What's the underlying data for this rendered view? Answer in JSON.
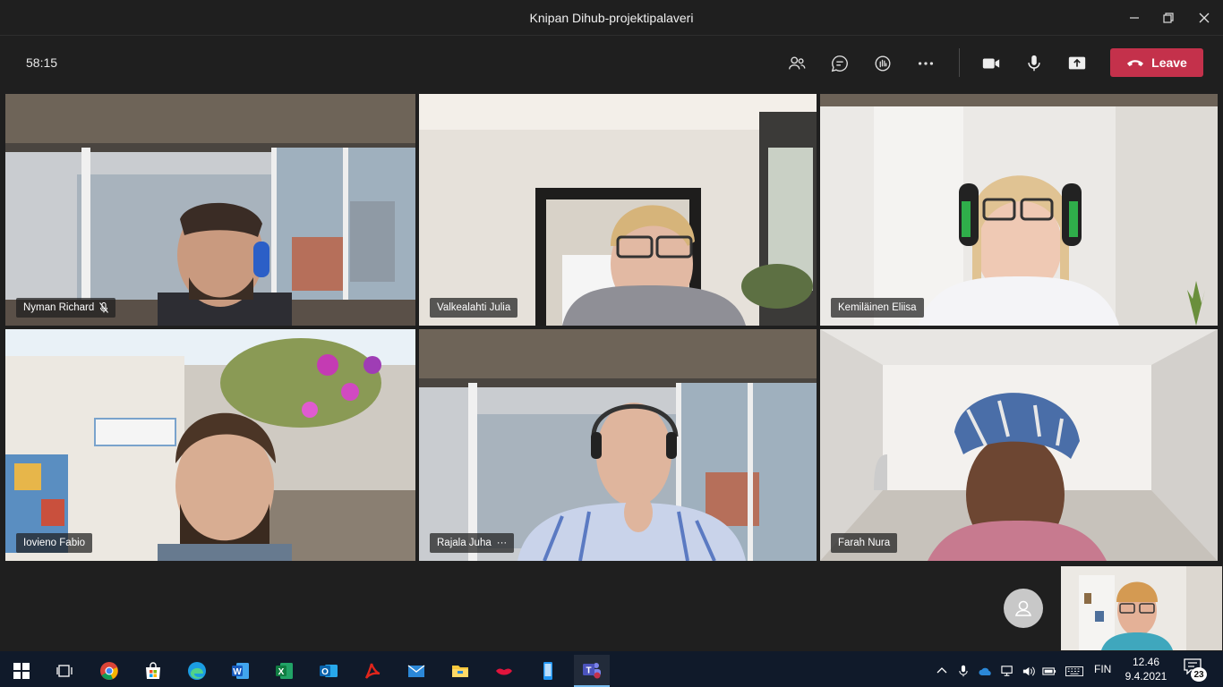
{
  "window": {
    "title": "Knipan Dihub-projektipalaveri"
  },
  "toolbar": {
    "timer": "58:15",
    "leave_label": "Leave",
    "buttons": [
      "participants-icon",
      "chat-icon",
      "raise-hand-icon",
      "more-icon",
      "camera-icon",
      "microphone-icon",
      "share-icon"
    ]
  },
  "participants": [
    {
      "name": "Nyman Richard",
      "muted": true
    },
    {
      "name": "Valkealahti Julia",
      "muted": false
    },
    {
      "name": "Kemiläinen Eliisa",
      "muted": false
    },
    {
      "name": "Iovieno Fabio",
      "muted": false
    },
    {
      "name": "Rajala Juha",
      "more": "···"
    },
    {
      "name": "Farah Nura",
      "muted": false
    }
  ],
  "taskbar": {
    "apps": [
      "start-icon",
      "task-view-icon",
      "chrome-icon",
      "store-icon",
      "edge-icon",
      "word-icon",
      "excel-icon",
      "outlook-icon",
      "acrobat-icon",
      "mail-icon",
      "file-explorer-icon",
      "app-lips-icon",
      "app-phone-icon",
      "teams-icon"
    ],
    "language": "FIN",
    "time": "12.46",
    "date": "9.4.2021",
    "notification_count": "23"
  },
  "colors": {
    "leave": "#c4314b",
    "background": "#1f1f1f",
    "taskbar": "#101a2a",
    "accent": "#76b9ed"
  }
}
